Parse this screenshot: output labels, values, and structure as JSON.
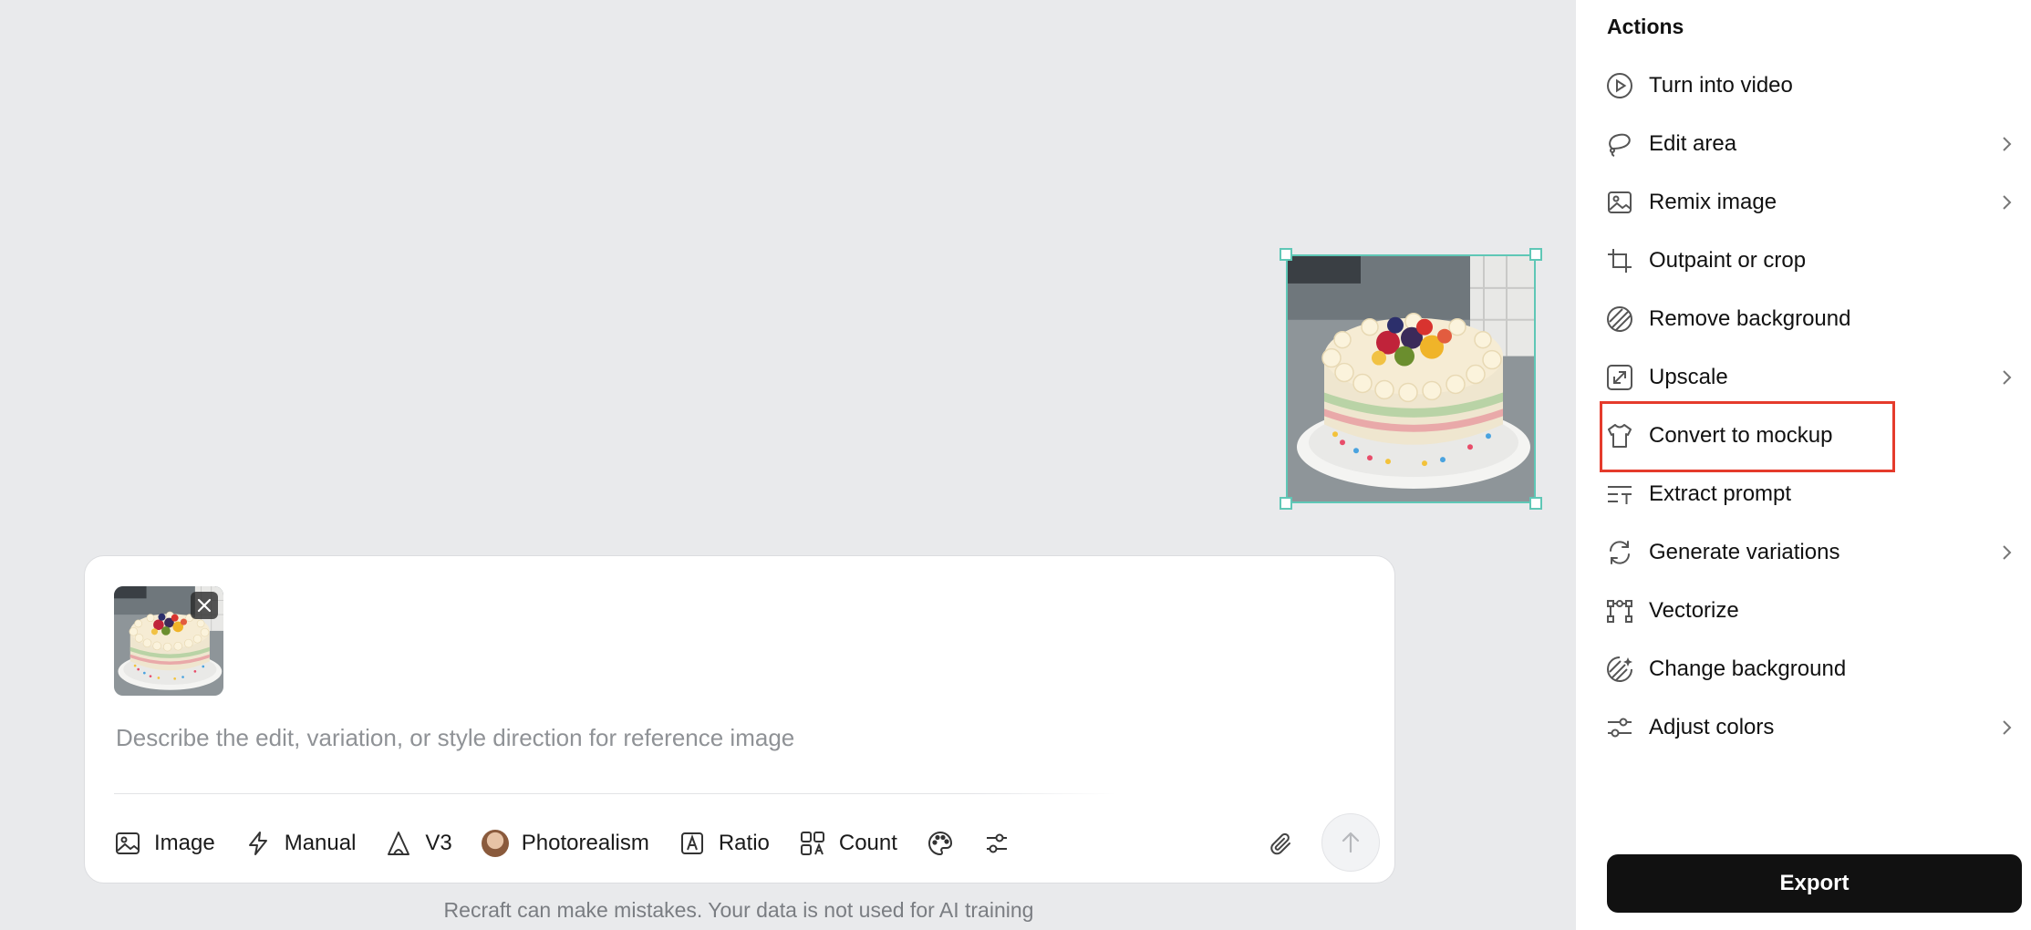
{
  "prompt": {
    "placeholder": "Describe the edit, variation, or style direction for reference image",
    "value": ""
  },
  "toolbar": {
    "items": [
      {
        "label": "Image",
        "icon": "image-icon"
      },
      {
        "label": "Manual",
        "icon": "lightning-icon"
      },
      {
        "label": "V3",
        "icon": "model-icon"
      },
      {
        "label": "Photorealism",
        "icon": "style-avatar-icon"
      },
      {
        "label": "Ratio",
        "icon": "ratio-icon"
      },
      {
        "label": "Count",
        "icon": "count-icon"
      }
    ],
    "icon_buttons": [
      "palette-icon",
      "sliders-icon"
    ],
    "attach_icon": "paperclip-icon",
    "send_icon": "arrow-up-icon"
  },
  "disclaimer": "Recraft can make mistakes. Your data is not used for AI training",
  "actions": {
    "title": "Actions",
    "items": [
      {
        "label": "Turn into video",
        "icon": "play-circle-icon",
        "submenu": false
      },
      {
        "label": "Edit area",
        "icon": "lasso-icon",
        "submenu": true
      },
      {
        "label": "Remix image",
        "icon": "image-icon",
        "submenu": true
      },
      {
        "label": "Outpaint or crop",
        "icon": "crop-icon",
        "submenu": false
      },
      {
        "label": "Remove background",
        "icon": "remove-bg-icon",
        "submenu": false
      },
      {
        "label": "Upscale",
        "icon": "upscale-icon",
        "submenu": true
      },
      {
        "label": "Convert to mockup",
        "icon": "tshirt-icon",
        "submenu": false,
        "highlighted": true
      },
      {
        "label": "Extract prompt",
        "icon": "text-lines-icon",
        "submenu": false
      },
      {
        "label": "Generate variations",
        "icon": "variations-icon",
        "submenu": true
      },
      {
        "label": "Vectorize",
        "icon": "vector-nodes-icon",
        "submenu": false
      },
      {
        "label": "Change background",
        "icon": "change-bg-icon",
        "submenu": false
      },
      {
        "label": "Adjust colors",
        "icon": "sliders-icon",
        "submenu": true
      }
    ],
    "export_label": "Export"
  },
  "colors": {
    "canvas_bg": "#e9eaec",
    "selection": "#5fc7b6",
    "highlight": "#e53b2c",
    "export_bg": "#111111"
  }
}
